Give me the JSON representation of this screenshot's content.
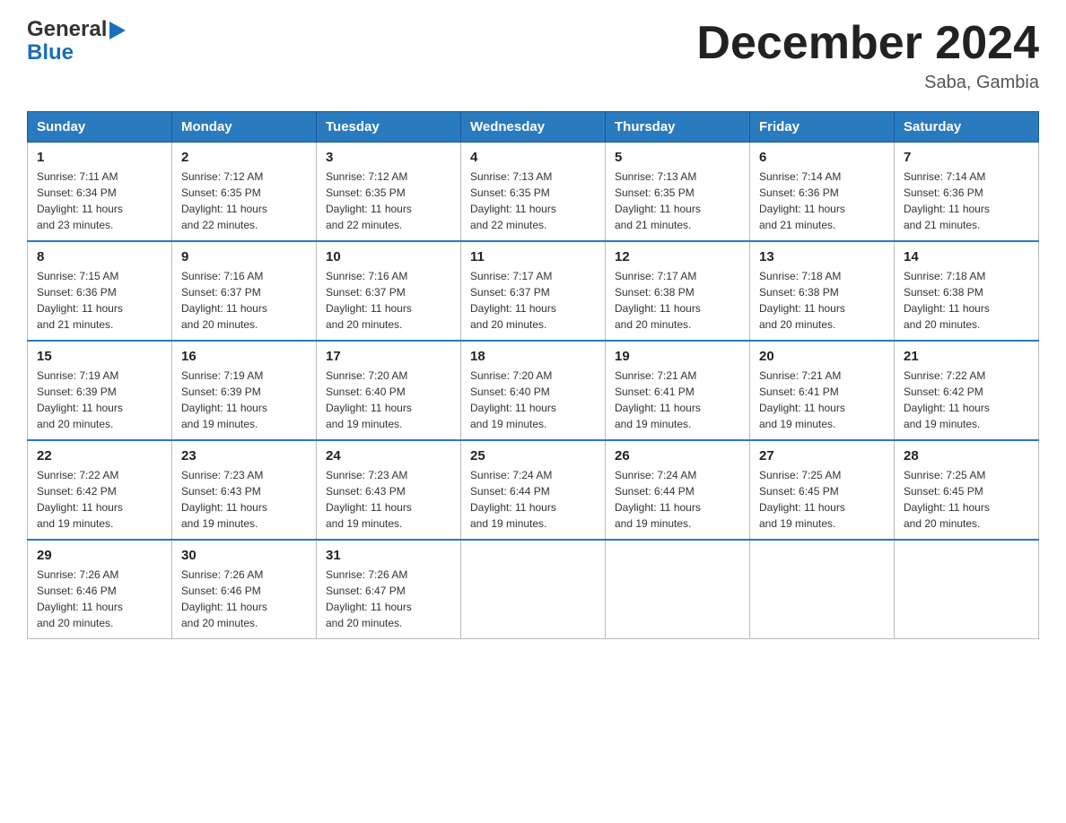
{
  "header": {
    "logo_part1": "General",
    "logo_part2": "Blue",
    "month_title": "December 2024",
    "location": "Saba, Gambia"
  },
  "days_of_week": [
    "Sunday",
    "Monday",
    "Tuesday",
    "Wednesday",
    "Thursday",
    "Friday",
    "Saturday"
  ],
  "weeks": [
    [
      {
        "day": "1",
        "sunrise": "7:11 AM",
        "sunset": "6:34 PM",
        "daylight": "11 hours and 23 minutes."
      },
      {
        "day": "2",
        "sunrise": "7:12 AM",
        "sunset": "6:35 PM",
        "daylight": "11 hours and 22 minutes."
      },
      {
        "day": "3",
        "sunrise": "7:12 AM",
        "sunset": "6:35 PM",
        "daylight": "11 hours and 22 minutes."
      },
      {
        "day": "4",
        "sunrise": "7:13 AM",
        "sunset": "6:35 PM",
        "daylight": "11 hours and 22 minutes."
      },
      {
        "day": "5",
        "sunrise": "7:13 AM",
        "sunset": "6:35 PM",
        "daylight": "11 hours and 21 minutes."
      },
      {
        "day": "6",
        "sunrise": "7:14 AM",
        "sunset": "6:36 PM",
        "daylight": "11 hours and 21 minutes."
      },
      {
        "day": "7",
        "sunrise": "7:14 AM",
        "sunset": "6:36 PM",
        "daylight": "11 hours and 21 minutes."
      }
    ],
    [
      {
        "day": "8",
        "sunrise": "7:15 AM",
        "sunset": "6:36 PM",
        "daylight": "11 hours and 21 minutes."
      },
      {
        "day": "9",
        "sunrise": "7:16 AM",
        "sunset": "6:37 PM",
        "daylight": "11 hours and 20 minutes."
      },
      {
        "day": "10",
        "sunrise": "7:16 AM",
        "sunset": "6:37 PM",
        "daylight": "11 hours and 20 minutes."
      },
      {
        "day": "11",
        "sunrise": "7:17 AM",
        "sunset": "6:37 PM",
        "daylight": "11 hours and 20 minutes."
      },
      {
        "day": "12",
        "sunrise": "7:17 AM",
        "sunset": "6:38 PM",
        "daylight": "11 hours and 20 minutes."
      },
      {
        "day": "13",
        "sunrise": "7:18 AM",
        "sunset": "6:38 PM",
        "daylight": "11 hours and 20 minutes."
      },
      {
        "day": "14",
        "sunrise": "7:18 AM",
        "sunset": "6:38 PM",
        "daylight": "11 hours and 20 minutes."
      }
    ],
    [
      {
        "day": "15",
        "sunrise": "7:19 AM",
        "sunset": "6:39 PM",
        "daylight": "11 hours and 20 minutes."
      },
      {
        "day": "16",
        "sunrise": "7:19 AM",
        "sunset": "6:39 PM",
        "daylight": "11 hours and 19 minutes."
      },
      {
        "day": "17",
        "sunrise": "7:20 AM",
        "sunset": "6:40 PM",
        "daylight": "11 hours and 19 minutes."
      },
      {
        "day": "18",
        "sunrise": "7:20 AM",
        "sunset": "6:40 PM",
        "daylight": "11 hours and 19 minutes."
      },
      {
        "day": "19",
        "sunrise": "7:21 AM",
        "sunset": "6:41 PM",
        "daylight": "11 hours and 19 minutes."
      },
      {
        "day": "20",
        "sunrise": "7:21 AM",
        "sunset": "6:41 PM",
        "daylight": "11 hours and 19 minutes."
      },
      {
        "day": "21",
        "sunrise": "7:22 AM",
        "sunset": "6:42 PM",
        "daylight": "11 hours and 19 minutes."
      }
    ],
    [
      {
        "day": "22",
        "sunrise": "7:22 AM",
        "sunset": "6:42 PM",
        "daylight": "11 hours and 19 minutes."
      },
      {
        "day": "23",
        "sunrise": "7:23 AM",
        "sunset": "6:43 PM",
        "daylight": "11 hours and 19 minutes."
      },
      {
        "day": "24",
        "sunrise": "7:23 AM",
        "sunset": "6:43 PM",
        "daylight": "11 hours and 19 minutes."
      },
      {
        "day": "25",
        "sunrise": "7:24 AM",
        "sunset": "6:44 PM",
        "daylight": "11 hours and 19 minutes."
      },
      {
        "day": "26",
        "sunrise": "7:24 AM",
        "sunset": "6:44 PM",
        "daylight": "11 hours and 19 minutes."
      },
      {
        "day": "27",
        "sunrise": "7:25 AM",
        "sunset": "6:45 PM",
        "daylight": "11 hours and 19 minutes."
      },
      {
        "day": "28",
        "sunrise": "7:25 AM",
        "sunset": "6:45 PM",
        "daylight": "11 hours and 20 minutes."
      }
    ],
    [
      {
        "day": "29",
        "sunrise": "7:26 AM",
        "sunset": "6:46 PM",
        "daylight": "11 hours and 20 minutes."
      },
      {
        "day": "30",
        "sunrise": "7:26 AM",
        "sunset": "6:46 PM",
        "daylight": "11 hours and 20 minutes."
      },
      {
        "day": "31",
        "sunrise": "7:26 AM",
        "sunset": "6:47 PM",
        "daylight": "11 hours and 20 minutes."
      },
      null,
      null,
      null,
      null
    ]
  ],
  "labels": {
    "sunrise": "Sunrise:",
    "sunset": "Sunset:",
    "daylight": "Daylight:"
  }
}
